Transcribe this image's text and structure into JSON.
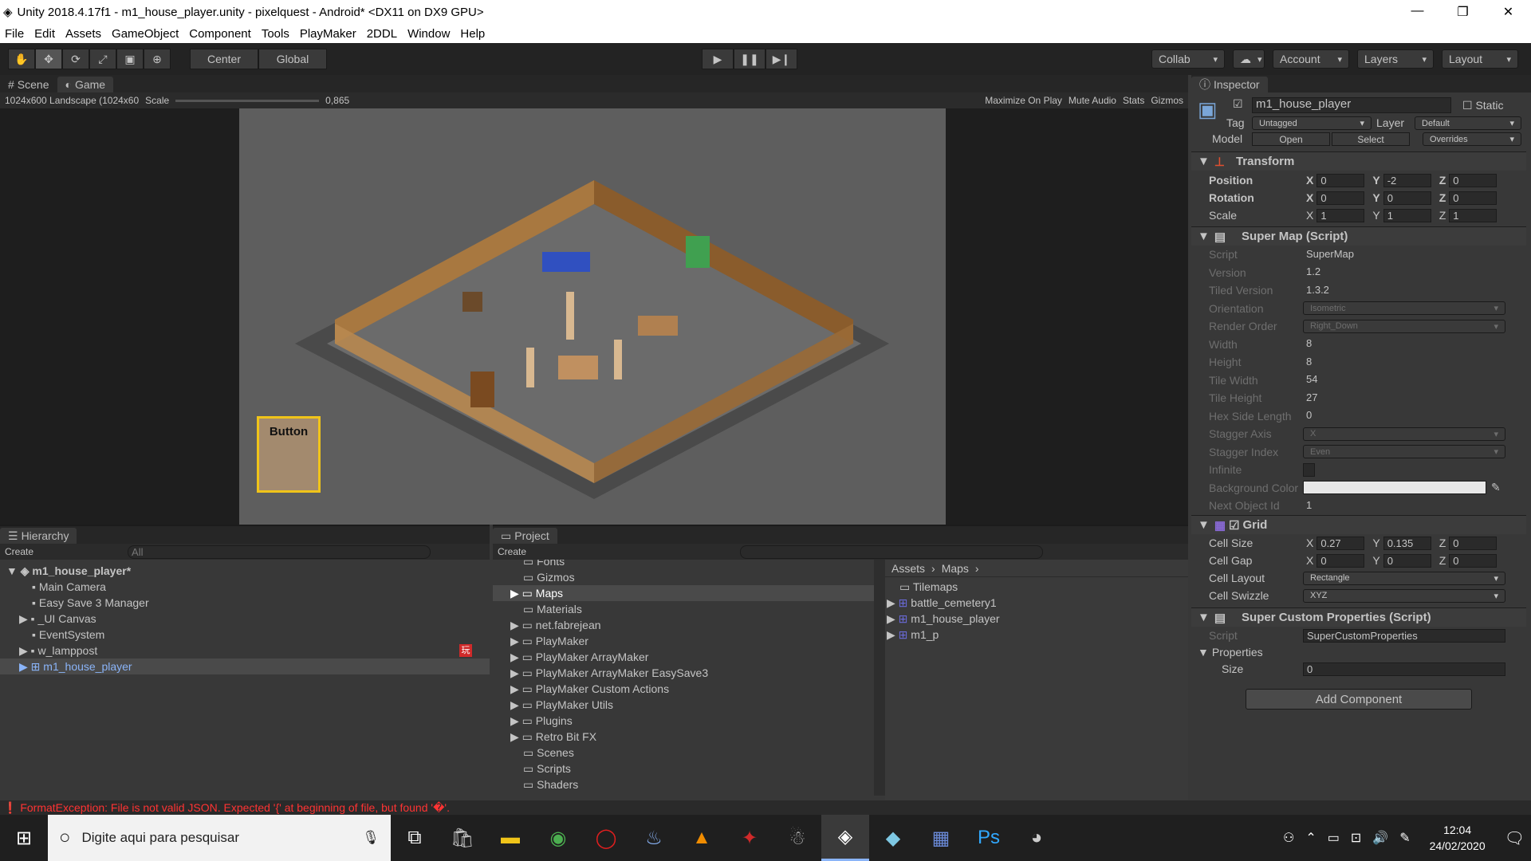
{
  "window": {
    "title": "Unity 2018.4.17f1 - m1_house_player.unity - pixelquest - Android* <DX11 on DX9 GPU>"
  },
  "menu": [
    "File",
    "Edit",
    "Assets",
    "GameObject",
    "Component",
    "Tools",
    "PlayMaker",
    "2DDL",
    "Window",
    "Help"
  ],
  "toolbar": {
    "center": "Center",
    "global": "Global",
    "collab": "Collab",
    "account": "Account",
    "layers": "Layers",
    "layout": "Layout"
  },
  "scene_tabs": {
    "scene": "Scene",
    "game": "Game"
  },
  "game_bar": {
    "resolution": "1024x600 Landscape (1024x60",
    "scale_label": "Scale",
    "scale_value": "0,865",
    "maximize": "Maximize On Play",
    "mute": "Mute Audio",
    "stats": "Stats",
    "gizmos": "Gizmos"
  },
  "game_view": {
    "button_label": "Button"
  },
  "hierarchy": {
    "title": "Hierarchy",
    "create": "Create",
    "search": "All",
    "scene": "m1_house_player*",
    "items": [
      "Main Camera",
      "Easy Save 3 Manager",
      "_UI Canvas",
      "EventSystem",
      "w_lamppost",
      "m1_house_player"
    ]
  },
  "project": {
    "title": "Project",
    "create": "Create",
    "folders": [
      "Fonts",
      "Gizmos",
      "Maps",
      "Materials",
      "net.fabrejean",
      "PlayMaker",
      "PlayMaker ArrayMaker",
      "PlayMaker ArrayMaker EasySave3",
      "PlayMaker Custom Actions",
      "PlayMaker Utils",
      "Plugins",
      "Retro Bit FX",
      "Scenes",
      "Scripts",
      "Shaders"
    ],
    "breadcrumb": [
      "Assets",
      "Maps"
    ],
    "assets": [
      "Tilemaps",
      "battle_cemetery1",
      "m1_house_player",
      "m1_p"
    ]
  },
  "inspector": {
    "title": "Inspector",
    "object": "m1_house_player",
    "static": "Static",
    "tag_label": "Tag",
    "tag": "Untagged",
    "layer_label": "Layer",
    "layer": "Default",
    "model_label": "Model",
    "open": "Open",
    "select": "Select",
    "overrides": "Overrides",
    "transform": {
      "title": "Transform",
      "position": {
        "label": "Position",
        "x": "0",
        "y": "-2",
        "z": "0"
      },
      "rotation": {
        "label": "Rotation",
        "x": "0",
        "y": "0",
        "z": "0"
      },
      "scale": {
        "label": "Scale",
        "x": "1",
        "y": "1",
        "z": "1"
      }
    },
    "supermap": {
      "title": "Super Map (Script)",
      "rows": [
        [
          "Script",
          "SuperMap"
        ],
        [
          "Version",
          "1.2"
        ],
        [
          "Tiled Version",
          "1.3.2"
        ],
        [
          "Orientation",
          "Isometric"
        ],
        [
          "Render Order",
          "Right_Down"
        ],
        [
          "Width",
          "8"
        ],
        [
          "Height",
          "8"
        ],
        [
          "Tile Width",
          "54"
        ],
        [
          "Tile Height",
          "27"
        ],
        [
          "Hex Side Length",
          "0"
        ],
        [
          "Stagger Axis",
          "X"
        ],
        [
          "Stagger Index",
          "Even"
        ],
        [
          "Infinite",
          ""
        ],
        [
          "Background Color",
          ""
        ],
        [
          "Next Object Id",
          "1"
        ]
      ]
    },
    "grid": {
      "title": "Grid",
      "cell_size": {
        "label": "Cell Size",
        "x": "0.27",
        "y": "0.135",
        "z": "0"
      },
      "cell_gap": {
        "label": "Cell Gap",
        "x": "0",
        "y": "0",
        "z": "0"
      },
      "cell_layout": {
        "label": "Cell Layout",
        "value": "Rectangle"
      },
      "cell_swizzle": {
        "label": "Cell Swizzle",
        "value": "XYZ"
      }
    },
    "custom": {
      "title": "Super Custom Properties (Script)",
      "script_label": "Script",
      "script": "SuperCustomProperties",
      "properties": "Properties",
      "size_label": "Size",
      "size": "0"
    },
    "add_component": "Add Component"
  },
  "console": {
    "error": "FormatException: File is not valid JSON. Expected '{' at beginning of file, but found '�'."
  },
  "taskbar": {
    "search": "Digite aqui para pesquisar",
    "time": "12:04",
    "date": "24/02/2020"
  },
  "colors": {
    "accent": "#f0c419",
    "error": "#ff3333",
    "selected": "#3e5f96"
  }
}
